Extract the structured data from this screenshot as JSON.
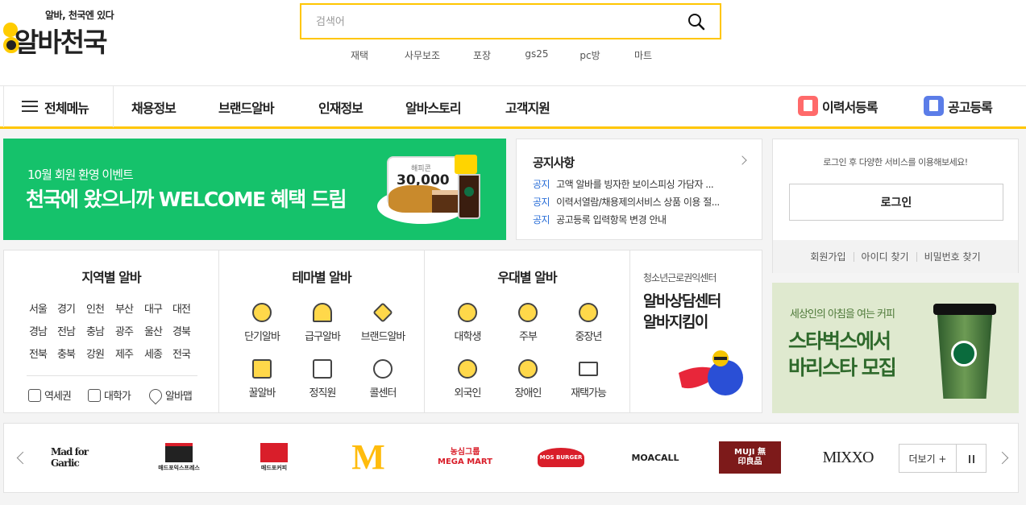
{
  "logo": {
    "tagline": "알바, 천국엔 있다",
    "name": "알바천국"
  },
  "search": {
    "placeholder": "검색어"
  },
  "keywords": [
    "재택",
    "사무보조",
    "포장",
    "gs25",
    "pc방",
    "마트"
  ],
  "nav": {
    "all_menu": "전체메뉴",
    "items": [
      "채용정보",
      "브랜드알바",
      "인재정보",
      "알바스토리",
      "고객지원"
    ],
    "resume": "이력서등록",
    "post_ad": "공고등록"
  },
  "banner": {
    "subtitle": "10월 회원 환영 이벤트",
    "title": "천국에 왔으니까 WELCOME 혜택 드림",
    "coupon_label": "해피콘",
    "coupon_value": "30,000"
  },
  "notice": {
    "title": "공지사항",
    "rows": [
      {
        "tag": "공지",
        "text": "고액 알바를 빙자한 보이스피싱 가담자 ..."
      },
      {
        "tag": "공지",
        "text": "이력서열람/채용제의서비스 상품 이용 절..."
      },
      {
        "tag": "공지",
        "text": "공고등록 입력항목 변경 안내"
      }
    ]
  },
  "login": {
    "message": "로그인 후 다양한 서비스를 이용해보세요!",
    "button": "로그인",
    "links": [
      "회원가입",
      "아이디 찾기",
      "비밀번호 찾기"
    ]
  },
  "region": {
    "title": "지역별 알바",
    "rows": [
      [
        "서울",
        "경기",
        "인천",
        "부산",
        "대구",
        "대전"
      ],
      [
        "경남",
        "전남",
        "충남",
        "광주",
        "울산",
        "경북"
      ],
      [
        "전북",
        "충북",
        "강원",
        "제주",
        "세종",
        "전국"
      ]
    ],
    "extras": [
      "역세권",
      "대학가",
      "알바맵"
    ]
  },
  "theme": {
    "title": "테마별 알바",
    "items": [
      "단기알바",
      "급구알바",
      "브랜드알바",
      "꿀알바",
      "정직원",
      "콜센터"
    ]
  },
  "benefit": {
    "title": "우대별 알바",
    "items": [
      "대학생",
      "주부",
      "중장년",
      "외국인",
      "장애인",
      "재택가능"
    ]
  },
  "counsel": {
    "subtitle": "청소년근로권익센터",
    "title_line1": "알바상담센터",
    "title_line2": "알바지킴이"
  },
  "starbucks": {
    "subtitle": "세상인의 아침을 여는 커피",
    "title_line1": "스타벅스에서",
    "title_line2": "바리스타 모집"
  },
  "brands": {
    "logos": [
      "Mad for Garlic",
      "매드포익스프레스",
      "매드포커피",
      "M",
      "농심그룹 MEGA MART",
      "MOS BURGER",
      "MOACALL",
      "MUJI 無印良品",
      "MIXXO"
    ],
    "more": "더보기 +"
  },
  "colors": {
    "accent": "#ffc600",
    "banner_green": "#15c26b",
    "notice_blue": "#2b6fd8"
  }
}
